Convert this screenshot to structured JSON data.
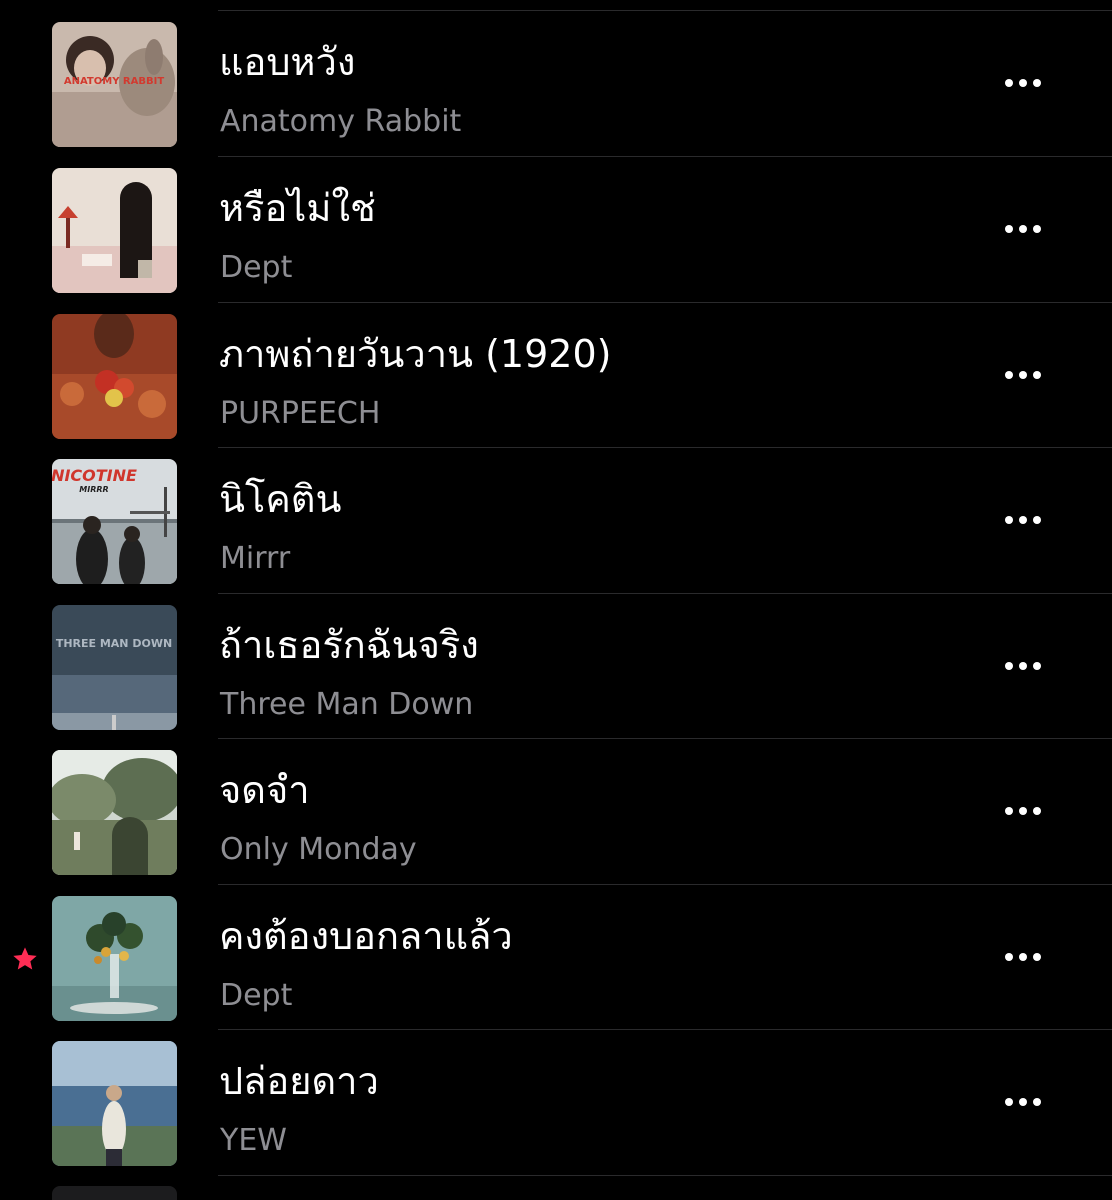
{
  "songs": [
    {
      "title": "แอบหวัง",
      "artist": "Anatomy Rabbit",
      "art_text": "ANATOMY RABBIT"
    },
    {
      "title": "หรือไม่ใช่",
      "artist": "Dept"
    },
    {
      "title": "ภาพถ่ายวันวาน (1920)",
      "artist": "PURPEECH"
    },
    {
      "title": "นิโคติน",
      "artist": "Mirrr",
      "art_text": "NICOTINE",
      "art_subtext": "MIRRR"
    },
    {
      "title": "ถ้าเธอรักฉันจริง",
      "artist": "Three Man Down",
      "art_text": "THREE MAN DOWN"
    },
    {
      "title": "จดจำ",
      "artist": "Only Monday"
    },
    {
      "title": "คงต้องบอกลาแล้ว",
      "artist": "Dept",
      "favorited": true
    },
    {
      "title": "ปล่อยดาว",
      "artist": "YEW"
    }
  ],
  "icons": {
    "more": "more-horizontal-icon",
    "favorite": "star-icon"
  },
  "colors": {
    "background": "#000000",
    "title": "#ffffff",
    "artist": "#8e8e93",
    "separator": "#2a2a2c",
    "favorite": "#ff2d55"
  }
}
